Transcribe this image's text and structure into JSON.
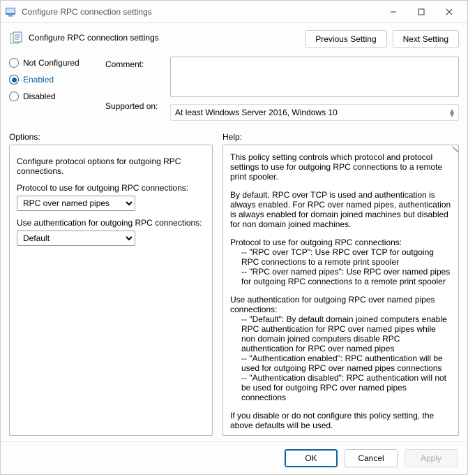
{
  "window": {
    "title": "Configure RPC connection settings"
  },
  "header": {
    "title": "Configure RPC connection settings"
  },
  "nav": {
    "prev": "Previous Setting",
    "next": "Next Setting"
  },
  "state": {
    "not_configured": "Not Configured",
    "enabled": "Enabled",
    "disabled": "Disabled",
    "selected": "enabled"
  },
  "labels": {
    "comment": "Comment:",
    "supported_on": "Supported on:",
    "options": "Options:",
    "help": "Help:"
  },
  "comment_value": "",
  "supported_on_value": "At least Windows Server 2016, Windows 10",
  "options": {
    "intro": "Configure protocol options for outgoing RPC connections.",
    "protocol_label": "Protocol to use for outgoing RPC connections:",
    "protocol_value": "RPC over named pipes",
    "auth_label": "Use authentication for outgoing RPC connections:",
    "auth_value": "Default"
  },
  "help": {
    "p1": "This policy setting controls which protocol and protocol settings to use for outgoing RPC connections to a remote print spooler.",
    "p2": "By default, RPC over TCP is used and authentication is always enabled. For RPC over named pipes, authentication is always enabled for domain joined machines but disabled for non domain joined machines.",
    "p3": "Protocol to use for outgoing RPC connections:",
    "p3a": "-- \"RPC over TCP\": Use RPC over TCP for outgoing RPC connections to a remote print spooler",
    "p3b": "-- \"RPC over named pipes\": Use RPC over named pipes for outgoing RPC connections to a remote print spooler",
    "p4": "Use authentication for outgoing RPC over named pipes connections:",
    "p4a": "-- \"Default\": By default domain joined computers enable RPC authentication for RPC over named pipes while non domain joined computers disable RPC authentication for RPC over named pipes",
    "p4b": "-- \"Authentication enabled\": RPC authentication will be used for outgoing RPC over named pipes connections",
    "p4c": "-- \"Authentication disabled\": RPC authentication will not be used for outgoing RPC over named pipes connections",
    "p5": "If you disable or do not configure this policy setting, the above defaults will be used."
  },
  "footer": {
    "ok": "OK",
    "cancel": "Cancel",
    "apply": "Apply"
  }
}
